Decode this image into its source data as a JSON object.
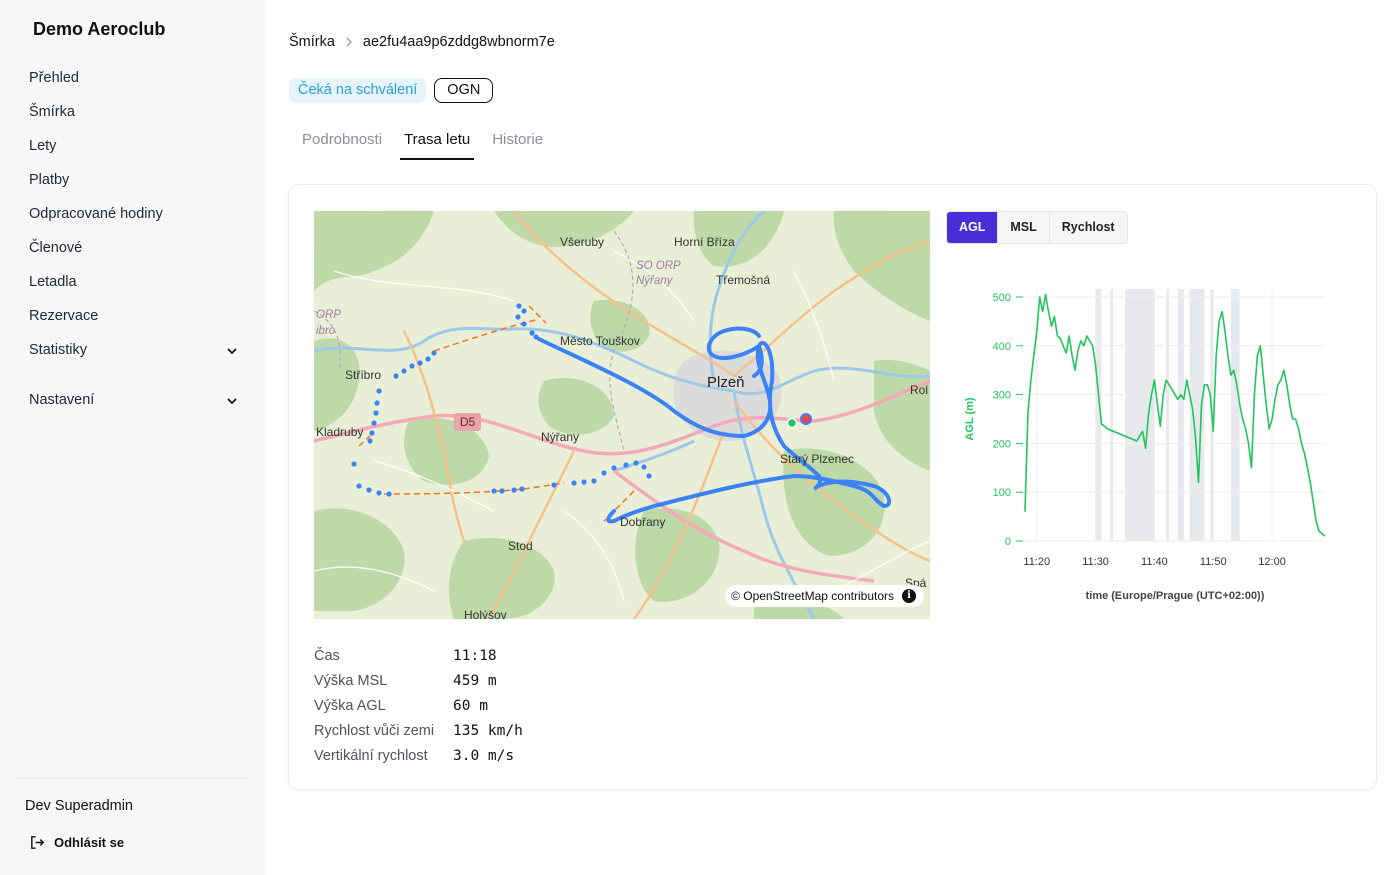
{
  "sidebar": {
    "brand": "Demo Aeroclub",
    "items": [
      {
        "label": "Přehled"
      },
      {
        "label": "Šmírka"
      },
      {
        "label": "Lety"
      },
      {
        "label": "Platby"
      },
      {
        "label": "Odpracované hodiny"
      },
      {
        "label": "Členové"
      },
      {
        "label": "Letadla"
      },
      {
        "label": "Rezervace"
      },
      {
        "label": "Statistiky"
      },
      {
        "label": "Nastavení"
      }
    ],
    "user_name": "Dev Superadmin",
    "logout_label": "Odhlásit se"
  },
  "breadcrumb": {
    "parent": "Šmírka",
    "current": "ae2fu4aa9p6zddg8wbnorm7e"
  },
  "badges": {
    "status": "Čeká na schválení",
    "source": "OGN"
  },
  "tabs": [
    {
      "label": "Podrobnosti",
      "active": false
    },
    {
      "label": "Trasa letu",
      "active": true
    },
    {
      "label": "Historie",
      "active": false
    }
  ],
  "map": {
    "labels": {
      "vseruby": "Všeruby",
      "horni_briza": "Horní Bříza",
      "so_orp": "SO ORP",
      "nyrany_orp": "Nýřany",
      "tremosna": "Třemošná",
      "orp": "ORP",
      "ibro": "ibro",
      "mesto_touskov": "Město Touškov",
      "stribro": "Stříbro",
      "plzen": "Plzeň",
      "rol": "Rol",
      "kladruby": "Kladruby",
      "nyrany": "Nýřany",
      "stary_plzenec": "Starý Plzenec",
      "dobrany": "Dobřany",
      "stod": "Stod",
      "holysov": "Holýšov",
      "spa": "Spá"
    },
    "road_shield": "D5",
    "attribution": "© OpenStreetMap contributors",
    "info_icon": "info-icon",
    "track_color": "#3b82f6",
    "gap_color": "#f97316"
  },
  "chart_toggle": [
    {
      "label": "AGL",
      "active": true
    },
    {
      "label": "MSL",
      "active": false
    },
    {
      "label": "Rychlost",
      "active": false
    }
  ],
  "chart_data": {
    "type": "line",
    "ylabel": "AGL (m)",
    "xlabel": "time (Europe/Prague (UTC+02:00))",
    "ylim": [
      0,
      520
    ],
    "y_ticks": [
      0,
      100,
      200,
      300,
      400,
      500
    ],
    "x_ticks": [
      "11:20",
      "11:30",
      "11:40",
      "11:50",
      "12:00"
    ],
    "color": "#22c55e",
    "series": [
      {
        "x": [
          "11:18",
          "11:18.5",
          "11:19",
          "11:19.5",
          "11:20",
          "11:20.5",
          "11:21",
          "11:21.5",
          "11:22",
          "11:22.5",
          "11:23",
          "11:23.5",
          "11:24",
          "11:24.5",
          "11:25",
          "11:25.5",
          "11:26",
          "11:26.5",
          "11:27",
          "11:27.5",
          "11:28",
          "11:28.5",
          "11:29",
          "11:29.5",
          "11:30",
          "11:30.5",
          "11:31",
          "11:31.5",
          "11:32",
          "11:33",
          "11:34",
          "11:35",
          "11:36",
          "11:37",
          "11:38",
          "11:38.5",
          "11:39",
          "11:39.5",
          "11:40",
          "11:40.5",
          "11:41",
          "11:41.5",
          "11:42",
          "11:42.5",
          "11:43",
          "11:43.5",
          "11:44",
          "11:44.5",
          "11:45",
          "11:45.5",
          "11:46",
          "11:46.5",
          "11:47",
          "11:47.5",
          "11:48",
          "11:48.5",
          "11:49",
          "11:49.5",
          "11:50",
          "11:50.5",
          "11:51",
          "11:51.5",
          "11:52",
          "11:52.5",
          "11:53",
          "11:53.5",
          "11:54",
          "11:54.5",
          "11:55",
          "11:55.5",
          "11:56",
          "11:56.5",
          "11:57",
          "11:57.5",
          "11:58",
          "11:58.5",
          "11:59",
          "11:59.5",
          "12:00",
          "12:00.5",
          "12:01",
          "12:01.5",
          "12:02",
          "12:02.5",
          "12:03",
          "12:03.5",
          "12:04",
          "12:04.5",
          "12:05",
          "12:05.5",
          "12:06",
          "12:06.5",
          "12:07",
          "12:07.5",
          "12:08",
          "12:08.5",
          "12:09"
        ],
        "values": [
          60,
          260,
          330,
          380,
          430,
          500,
          470,
          505,
          470,
          440,
          460,
          420,
          415,
          400,
          385,
          420,
          380,
          350,
          390,
          410,
          400,
          420,
          410,
          400,
          360,
          300,
          240,
          235,
          230,
          225,
          220,
          215,
          210,
          205,
          225,
          190,
          260,
          300,
          330,
          280,
          235,
          300,
          330,
          320,
          310,
          300,
          290,
          300,
          290,
          330,
          300,
          270,
          210,
          120,
          280,
          320,
          320,
          300,
          225,
          380,
          450,
          470,
          430,
          380,
          340,
          350,
          320,
          280,
          250,
          230,
          200,
          150,
          300,
          380,
          400,
          340,
          280,
          230,
          250,
          290,
          320,
          330,
          350,
          320,
          280,
          250,
          250,
          230,
          200,
          180,
          150,
          120,
          80,
          40,
          20,
          15,
          10
        ]
      }
    ],
    "gray_bands_note": "shaded intervals"
  },
  "details": [
    {
      "label": "Čas",
      "value": "11:18"
    },
    {
      "label": "Výška MSL",
      "value": "459 m"
    },
    {
      "label": "Výška AGL",
      "value": "60 m"
    },
    {
      "label": "Rychlost vůči zemi",
      "value": "135 km/h"
    },
    {
      "label": "Vertikální rychlost",
      "value": "3.0 m/s"
    }
  ]
}
